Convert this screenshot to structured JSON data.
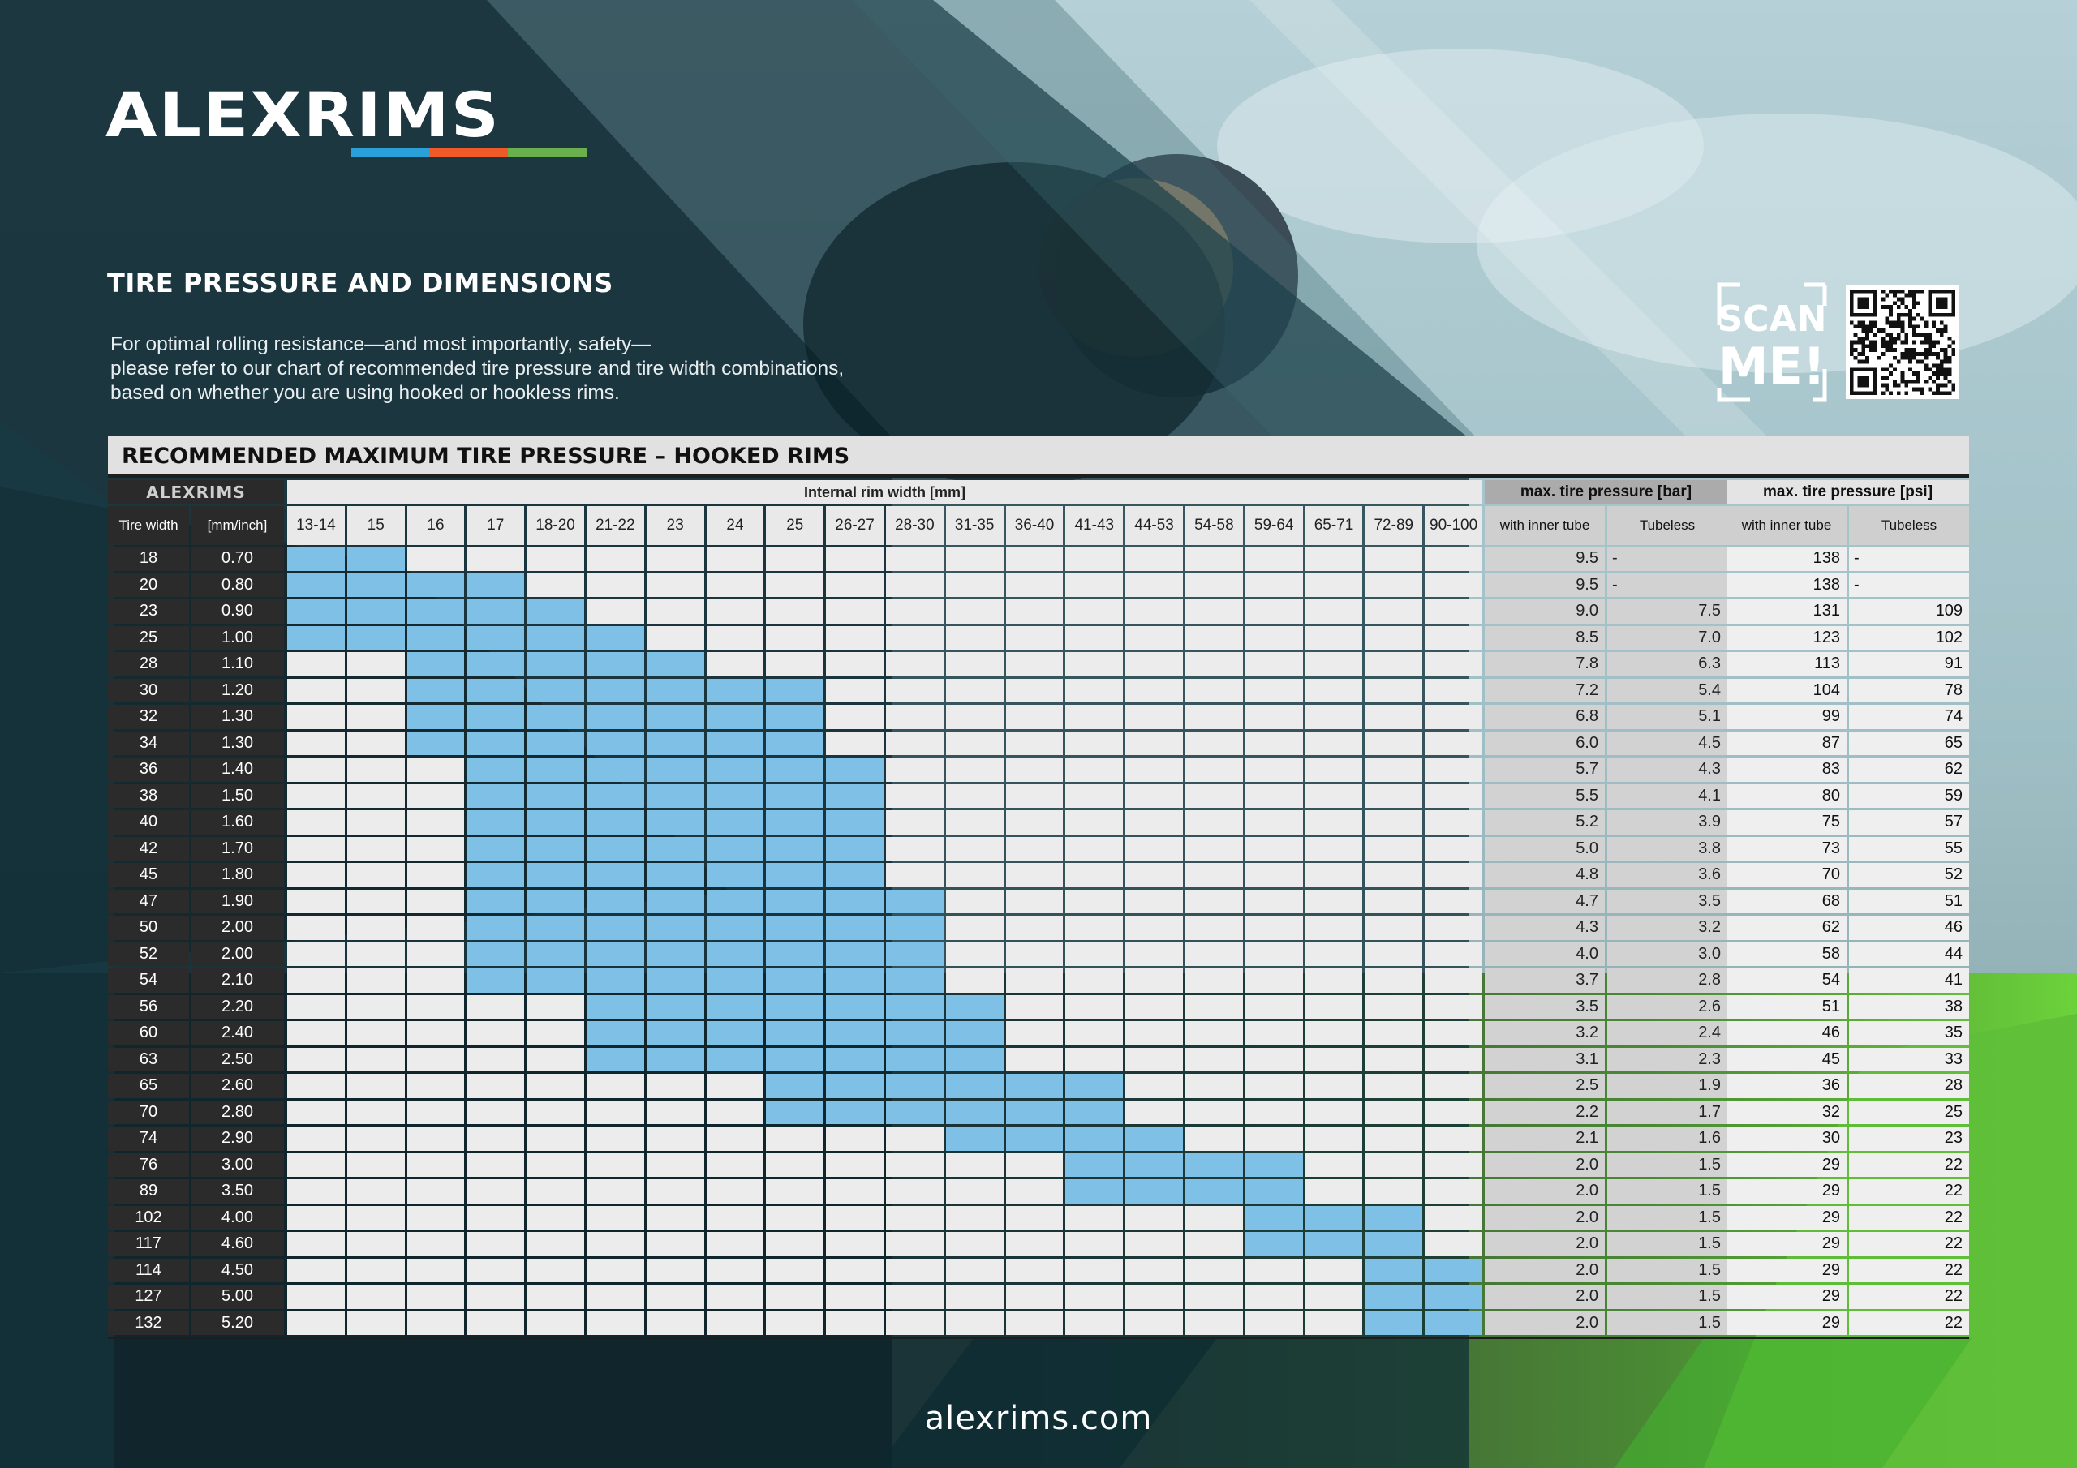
{
  "brand": {
    "name": "ALEXRIMS",
    "colors": {
      "blue": "#2a9fd8",
      "orange": "#f05a28",
      "green": "#6ab04c",
      "cell_fill": "#7fc1e6"
    }
  },
  "heading": "TIRE PRESSURE AND DIMENSIONS",
  "intro": [
    "For optimal rolling resistance—and most importantly, safety—",
    "please refer to our chart of recommended tire pressure and tire width combinations,",
    "based on whether you are using hooked or hookless rims."
  ],
  "scan": {
    "line1": "SCAN",
    "line2": "ME!"
  },
  "table": {
    "title": "RECOMMENDED MAXIMUM TIRE PRESSURE – HOOKED RIMS",
    "logo": "ALEXRIMS",
    "group_rim_width": "Internal rim width [mm]",
    "group_bar": "max. tire pressure [bar]",
    "group_psi": "max. tire pressure [psi]",
    "col_tire_width": "Tire width",
    "col_units": "[mm/inch]",
    "rim_widths": [
      "13-14",
      "15",
      "16",
      "17",
      "18-20",
      "21-22",
      "23",
      "24",
      "25",
      "26-27",
      "28-30",
      "31-35",
      "36-40",
      "41-43",
      "44-53",
      "54-58",
      "59-64",
      "65-71",
      "72-89",
      "90-100"
    ],
    "sub_inner_tube": "with inner tube",
    "sub_tubeless": "Tubeless",
    "rows": [
      {
        "mm": "18",
        "inch": "0.70",
        "start": 0,
        "end": 1,
        "bar_tube": "9.5",
        "bar_tl": "-",
        "psi_tube": "138",
        "psi_tl": "-"
      },
      {
        "mm": "20",
        "inch": "0.80",
        "start": 0,
        "end": 3,
        "bar_tube": "9.5",
        "bar_tl": "-",
        "psi_tube": "138",
        "psi_tl": "-"
      },
      {
        "mm": "23",
        "inch": "0.90",
        "start": 0,
        "end": 4,
        "bar_tube": "9.0",
        "bar_tl": "7.5",
        "psi_tube": "131",
        "psi_tl": "109"
      },
      {
        "mm": "25",
        "inch": "1.00",
        "start": 0,
        "end": 5,
        "bar_tube": "8.5",
        "bar_tl": "7.0",
        "psi_tube": "123",
        "psi_tl": "102"
      },
      {
        "mm": "28",
        "inch": "1.10",
        "start": 2,
        "end": 6,
        "bar_tube": "7.8",
        "bar_tl": "6.3",
        "psi_tube": "113",
        "psi_tl": "91"
      },
      {
        "mm": "30",
        "inch": "1.20",
        "start": 2,
        "end": 8,
        "bar_tube": "7.2",
        "bar_tl": "5.4",
        "psi_tube": "104",
        "psi_tl": "78"
      },
      {
        "mm": "32",
        "inch": "1.30",
        "start": 2,
        "end": 8,
        "bar_tube": "6.8",
        "bar_tl": "5.1",
        "psi_tube": "99",
        "psi_tl": "74"
      },
      {
        "mm": "34",
        "inch": "1.30",
        "start": 2,
        "end": 8,
        "bar_tube": "6.0",
        "bar_tl": "4.5",
        "psi_tube": "87",
        "psi_tl": "65"
      },
      {
        "mm": "36",
        "inch": "1.40",
        "start": 3,
        "end": 9,
        "bar_tube": "5.7",
        "bar_tl": "4.3",
        "psi_tube": "83",
        "psi_tl": "62"
      },
      {
        "mm": "38",
        "inch": "1.50",
        "start": 3,
        "end": 9,
        "bar_tube": "5.5",
        "bar_tl": "4.1",
        "psi_tube": "80",
        "psi_tl": "59"
      },
      {
        "mm": "40",
        "inch": "1.60",
        "start": 3,
        "end": 9,
        "bar_tube": "5.2",
        "bar_tl": "3.9",
        "psi_tube": "75",
        "psi_tl": "57"
      },
      {
        "mm": "42",
        "inch": "1.70",
        "start": 3,
        "end": 9,
        "bar_tube": "5.0",
        "bar_tl": "3.8",
        "psi_tube": "73",
        "psi_tl": "55"
      },
      {
        "mm": "45",
        "inch": "1.80",
        "start": 3,
        "end": 9,
        "bar_tube": "4.8",
        "bar_tl": "3.6",
        "psi_tube": "70",
        "psi_tl": "52"
      },
      {
        "mm": "47",
        "inch": "1.90",
        "start": 3,
        "end": 10,
        "bar_tube": "4.7",
        "bar_tl": "3.5",
        "psi_tube": "68",
        "psi_tl": "51"
      },
      {
        "mm": "50",
        "inch": "2.00",
        "start": 3,
        "end": 10,
        "bar_tube": "4.3",
        "bar_tl": "3.2",
        "psi_tube": "62",
        "psi_tl": "46"
      },
      {
        "mm": "52",
        "inch": "2.00",
        "start": 3,
        "end": 10,
        "bar_tube": "4.0",
        "bar_tl": "3.0",
        "psi_tube": "58",
        "psi_tl": "44"
      },
      {
        "mm": "54",
        "inch": "2.10",
        "start": 3,
        "end": 10,
        "bar_tube": "3.7",
        "bar_tl": "2.8",
        "psi_tube": "54",
        "psi_tl": "41"
      },
      {
        "mm": "56",
        "inch": "2.20",
        "start": 5,
        "end": 11,
        "bar_tube": "3.5",
        "bar_tl": "2.6",
        "psi_tube": "51",
        "psi_tl": "38"
      },
      {
        "mm": "60",
        "inch": "2.40",
        "start": 5,
        "end": 11,
        "bar_tube": "3.2",
        "bar_tl": "2.4",
        "psi_tube": "46",
        "psi_tl": "35"
      },
      {
        "mm": "63",
        "inch": "2.50",
        "start": 5,
        "end": 11,
        "bar_tube": "3.1",
        "bar_tl": "2.3",
        "psi_tube": "45",
        "psi_tl": "33"
      },
      {
        "mm": "65",
        "inch": "2.60",
        "start": 8,
        "end": 13,
        "bar_tube": "2.5",
        "bar_tl": "1.9",
        "psi_tube": "36",
        "psi_tl": "28"
      },
      {
        "mm": "70",
        "inch": "2.80",
        "start": 8,
        "end": 13,
        "bar_tube": "2.2",
        "bar_tl": "1.7",
        "psi_tube": "32",
        "psi_tl": "25"
      },
      {
        "mm": "74",
        "inch": "2.90",
        "start": 11,
        "end": 14,
        "bar_tube": "2.1",
        "bar_tl": "1.6",
        "psi_tube": "30",
        "psi_tl": "23"
      },
      {
        "mm": "76",
        "inch": "3.00",
        "start": 13,
        "end": 16,
        "bar_tube": "2.0",
        "bar_tl": "1.5",
        "psi_tube": "29",
        "psi_tl": "22"
      },
      {
        "mm": "89",
        "inch": "3.50",
        "start": 13,
        "end": 16,
        "bar_tube": "2.0",
        "bar_tl": "1.5",
        "psi_tube": "29",
        "psi_tl": "22"
      },
      {
        "mm": "102",
        "inch": "4.00",
        "start": 16,
        "end": 18,
        "bar_tube": "2.0",
        "bar_tl": "1.5",
        "psi_tube": "29",
        "psi_tl": "22"
      },
      {
        "mm": "117",
        "inch": "4.60",
        "start": 16,
        "end": 18,
        "bar_tube": "2.0",
        "bar_tl": "1.5",
        "psi_tube": "29",
        "psi_tl": "22"
      },
      {
        "mm": "114",
        "inch": "4.50",
        "start": 18,
        "end": 19,
        "bar_tube": "2.0",
        "bar_tl": "1.5",
        "psi_tube": "29",
        "psi_tl": "22"
      },
      {
        "mm": "127",
        "inch": "5.00",
        "start": 18,
        "end": 19,
        "bar_tube": "2.0",
        "bar_tl": "1.5",
        "psi_tube": "29",
        "psi_tl": "22"
      },
      {
        "mm": "132",
        "inch": "5.20",
        "start": 18,
        "end": 19,
        "bar_tube": "2.0",
        "bar_tl": "1.5",
        "psi_tube": "29",
        "psi_tl": "22"
      }
    ]
  },
  "footer_url": "alexrims.com"
}
